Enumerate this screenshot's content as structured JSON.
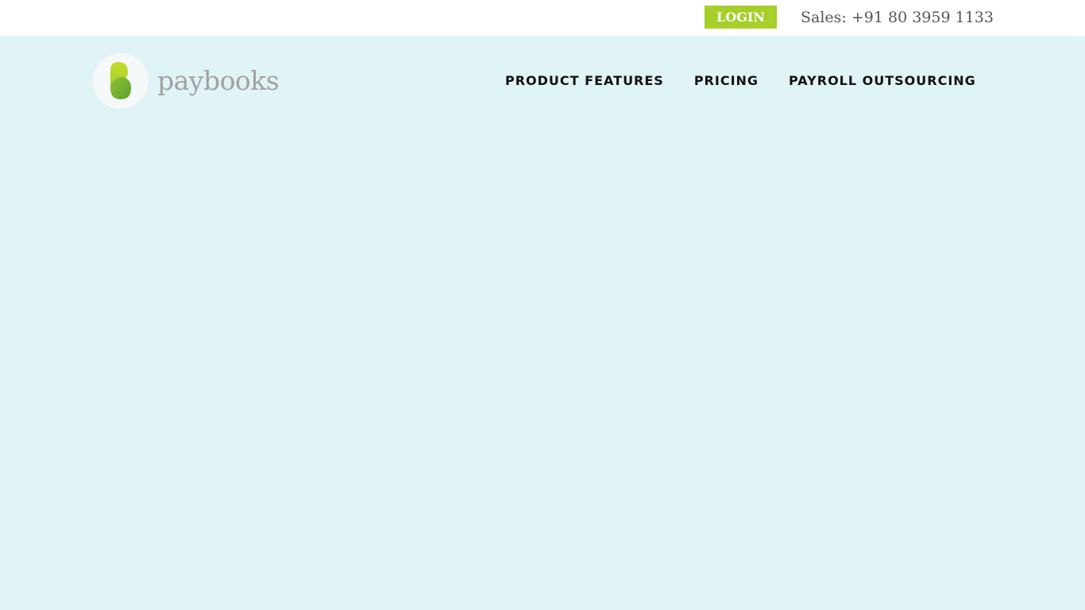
{
  "topbar": {
    "login_label": "LOGIN",
    "sales_phone": "Sales: +91 80 3959 1133"
  },
  "header": {
    "logo_text": "paybooks",
    "nav": [
      {
        "label": "PRODUCT FEATURES"
      },
      {
        "label": "PRICING"
      },
      {
        "label": "PAYROLL OUTSOURCING"
      }
    ]
  },
  "colors": {
    "page_background": "#e0f3f7",
    "accent_green": "#a6cf2a",
    "logo_text": "#a2a2a2"
  },
  "icons": {
    "logo": "paybooks-logo-icon"
  }
}
